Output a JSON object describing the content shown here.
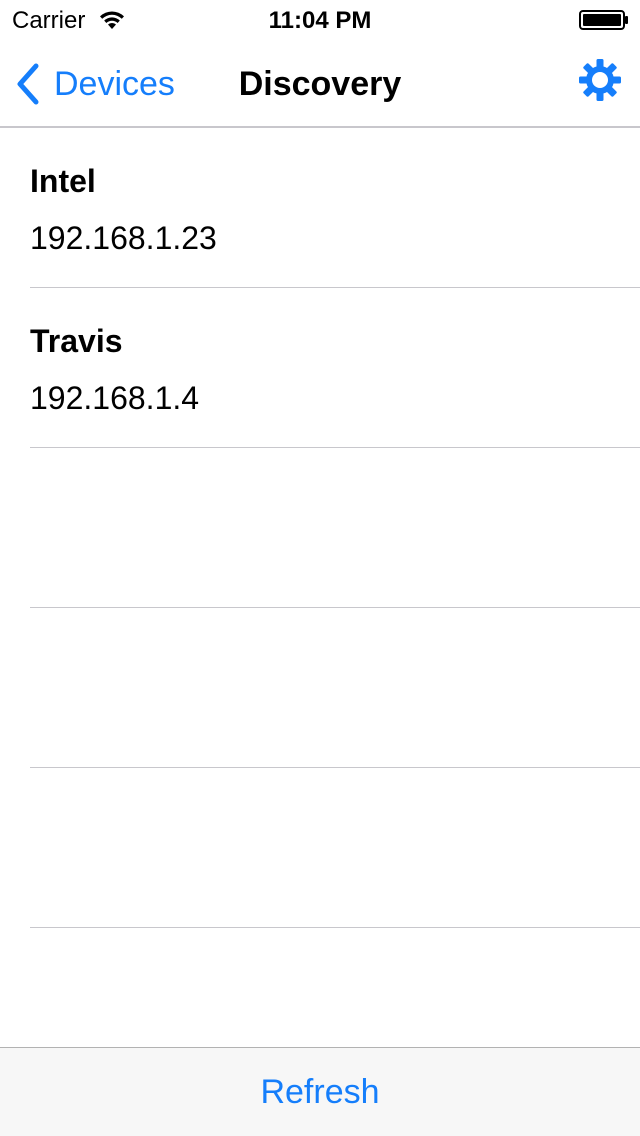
{
  "status_bar": {
    "carrier": "Carrier",
    "time": "11:04 PM",
    "icons": [
      "wifi-icon",
      "battery-icon"
    ]
  },
  "nav_bar": {
    "back_label": "Devices",
    "title": "Discovery",
    "back_icon": "chevron-left-icon",
    "settings_icon": "gear-icon"
  },
  "devices": [
    {
      "name": "Intel",
      "ip": "192.168.1.23"
    },
    {
      "name": "Travis",
      "ip": "192.168.1.4"
    }
  ],
  "toolbar": {
    "refresh_label": "Refresh"
  },
  "colors": {
    "accent": "#157efb",
    "separator": "#c8c7cc",
    "toolbar_bg": "#f7f7f7"
  }
}
